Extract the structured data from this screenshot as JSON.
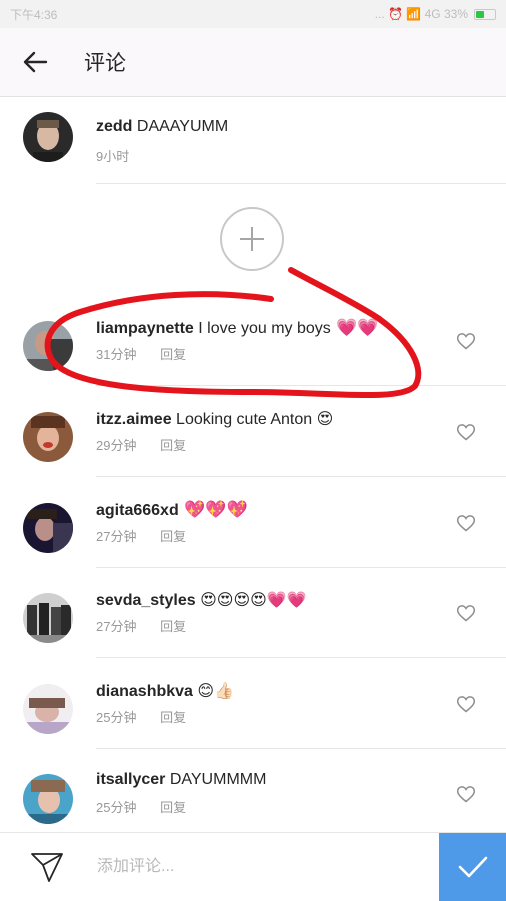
{
  "status_bar": {
    "left_text": "下午4:36",
    "right_text": "... ⏰ 📶 4G 33%"
  },
  "header": {
    "title": "评论"
  },
  "caption": {
    "username": "zedd",
    "text": "DAAAYUMM",
    "time": "9小时"
  },
  "comments": [
    {
      "username": "liampaynette",
      "text": "I love you my boys",
      "emoji": "💗💗",
      "time": "31分钟",
      "reply": "回复"
    },
    {
      "username": "itzz.aimee",
      "text": "Looking cute Anton",
      "emoji": "😍",
      "time": "29分钟",
      "reply": "回复"
    },
    {
      "username": "agita666xd",
      "text": "",
      "emoji": "💖💖💖",
      "time": "27分钟",
      "reply": "回复"
    },
    {
      "username": "sevda_styles",
      "text": "",
      "emoji": "😍😍😍😍💗💗",
      "time": "27分钟",
      "reply": "回复"
    },
    {
      "username": "dianashbkva",
      "text": "",
      "emoji": "😊👍🏻",
      "time": "25分钟",
      "reply": "回复"
    },
    {
      "username": "itsallycer",
      "text": "DAYUMMMM",
      "emoji": "",
      "time": "25分钟",
      "reply": "回复"
    }
  ],
  "input": {
    "placeholder": "添加评论..."
  },
  "colors": {
    "accent": "#4f9ae8",
    "annotation": "#e3141c",
    "heart": "#e2559c"
  }
}
